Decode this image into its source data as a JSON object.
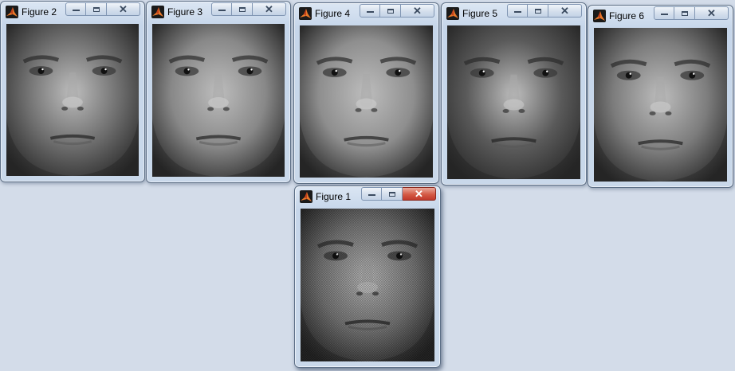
{
  "windows": [
    {
      "id": "fig2",
      "title": "Figure 2",
      "image": "grayscale face photo",
      "tone": "#6e6e6e"
    },
    {
      "id": "fig3",
      "title": "Figure 3",
      "image": "grayscale face photo",
      "tone": "#888888"
    },
    {
      "id": "fig4",
      "title": "Figure 4",
      "image": "grayscale face photo",
      "tone": "#8e8e8e"
    },
    {
      "id": "fig5",
      "title": "Figure 5",
      "image": "grayscale face photo",
      "tone": "#5a5a5a"
    },
    {
      "id": "fig6",
      "title": "Figure 6",
      "image": "grayscale face photo",
      "tone": "#7c7c7c"
    },
    {
      "id": "fig1",
      "title": "Figure 1",
      "image": "grayscale face photo, crosshatch noise",
      "tone": "#7a7a7a",
      "active": true
    }
  ],
  "caption_buttons": {
    "minimize": "minimize-icon",
    "maximize": "maximize-icon",
    "close": "close-icon"
  },
  "colors": {
    "desktop": "#d3dce9",
    "active_close": "#c94a37"
  }
}
